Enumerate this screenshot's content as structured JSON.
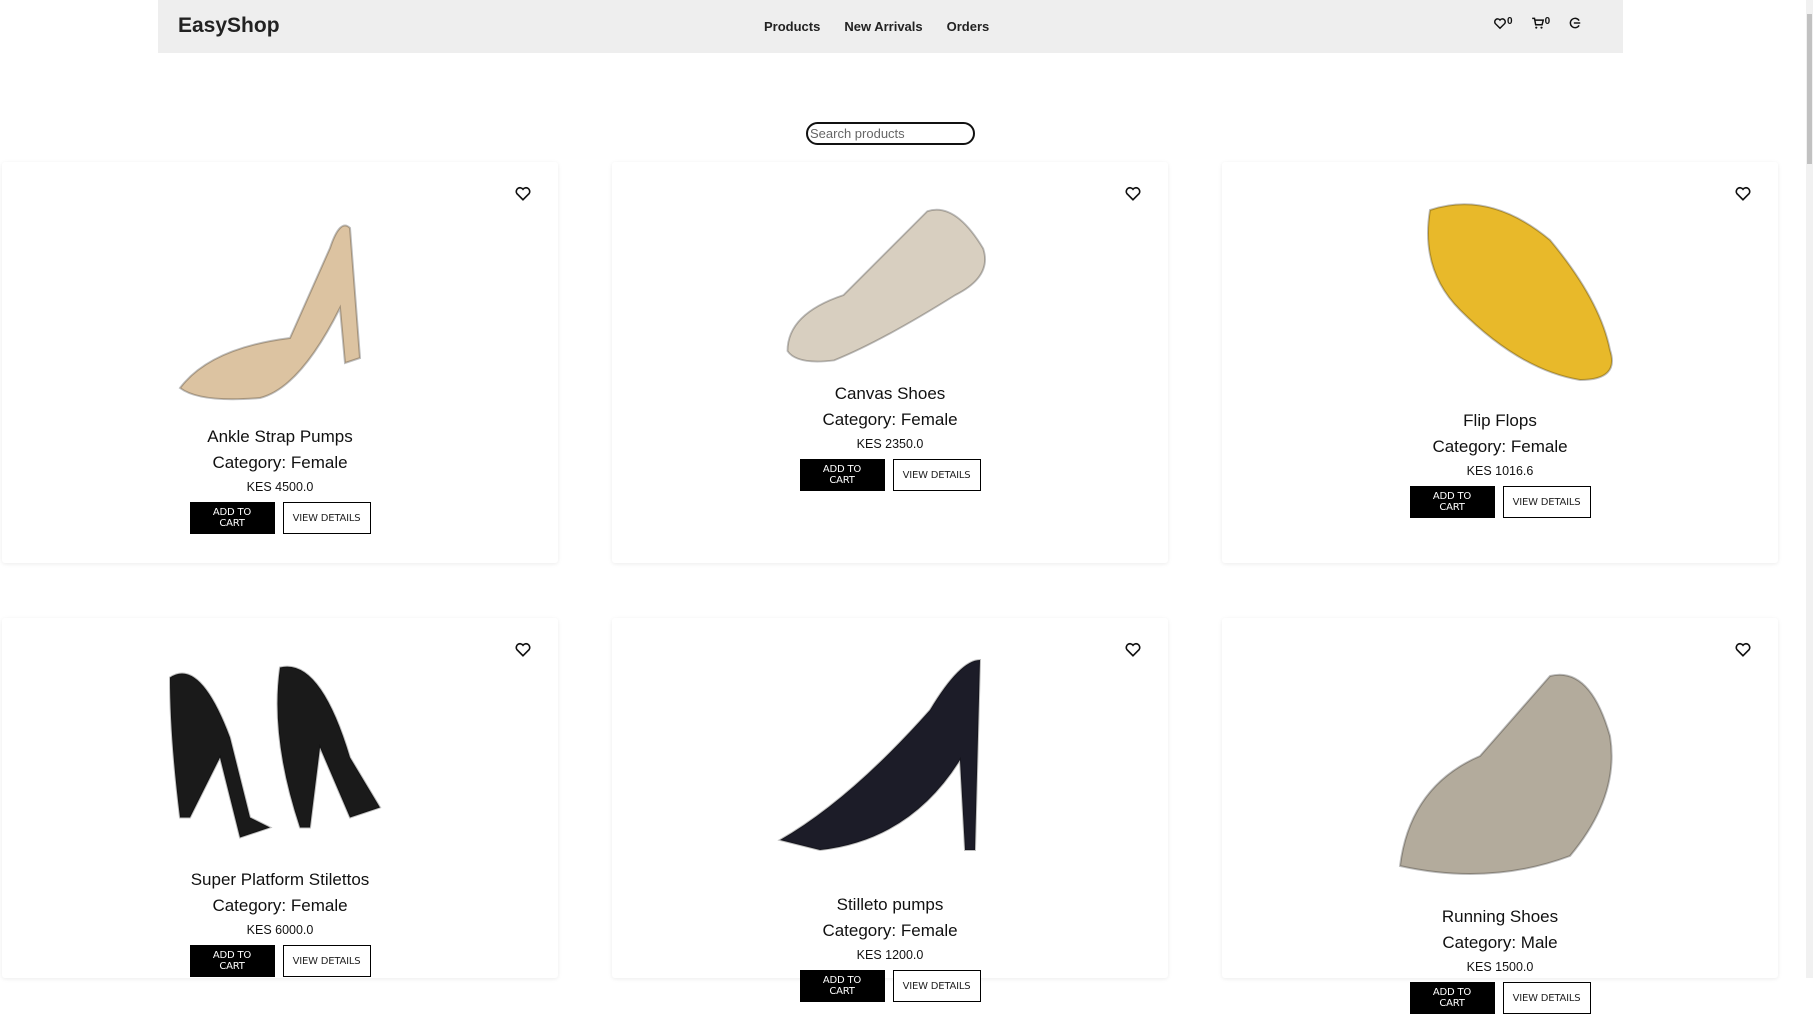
{
  "header": {
    "logo": "EasyShop",
    "nav": [
      "Products",
      "New Arrivals",
      "Orders"
    ],
    "wishlist_count": "0",
    "cart_count": "0"
  },
  "search": {
    "placeholder": "Search products",
    "value": ""
  },
  "buttons": {
    "add_to_cart": "ADD TO CART",
    "view_details": "VIEW DETAILS"
  },
  "products": [
    {
      "name": "Ankle Strap Pumps",
      "category": "Category: Female",
      "price": "KES 4500.0",
      "color": "#dcc3a1"
    },
    {
      "name": "Canvas Shoes",
      "category": "Category: Female",
      "price": "KES 2350.0",
      "color": "#d8cfc0"
    },
    {
      "name": "Flip Flops",
      "category": "Category: Female",
      "price": "KES 1016.6",
      "color": "#e8b92a"
    },
    {
      "name": "Super Platform Stilettos",
      "category": "Category: Female",
      "price": "KES 6000.0",
      "color": "#1a1a1a"
    },
    {
      "name": "Stilleto pumps",
      "category": "Category: Female",
      "price": "KES 1200.0",
      "color": "#1c1c28"
    },
    {
      "name": "Running Shoes",
      "category": "Category: Male",
      "price": "KES 1500.0",
      "color": "#b3ab9c"
    }
  ]
}
